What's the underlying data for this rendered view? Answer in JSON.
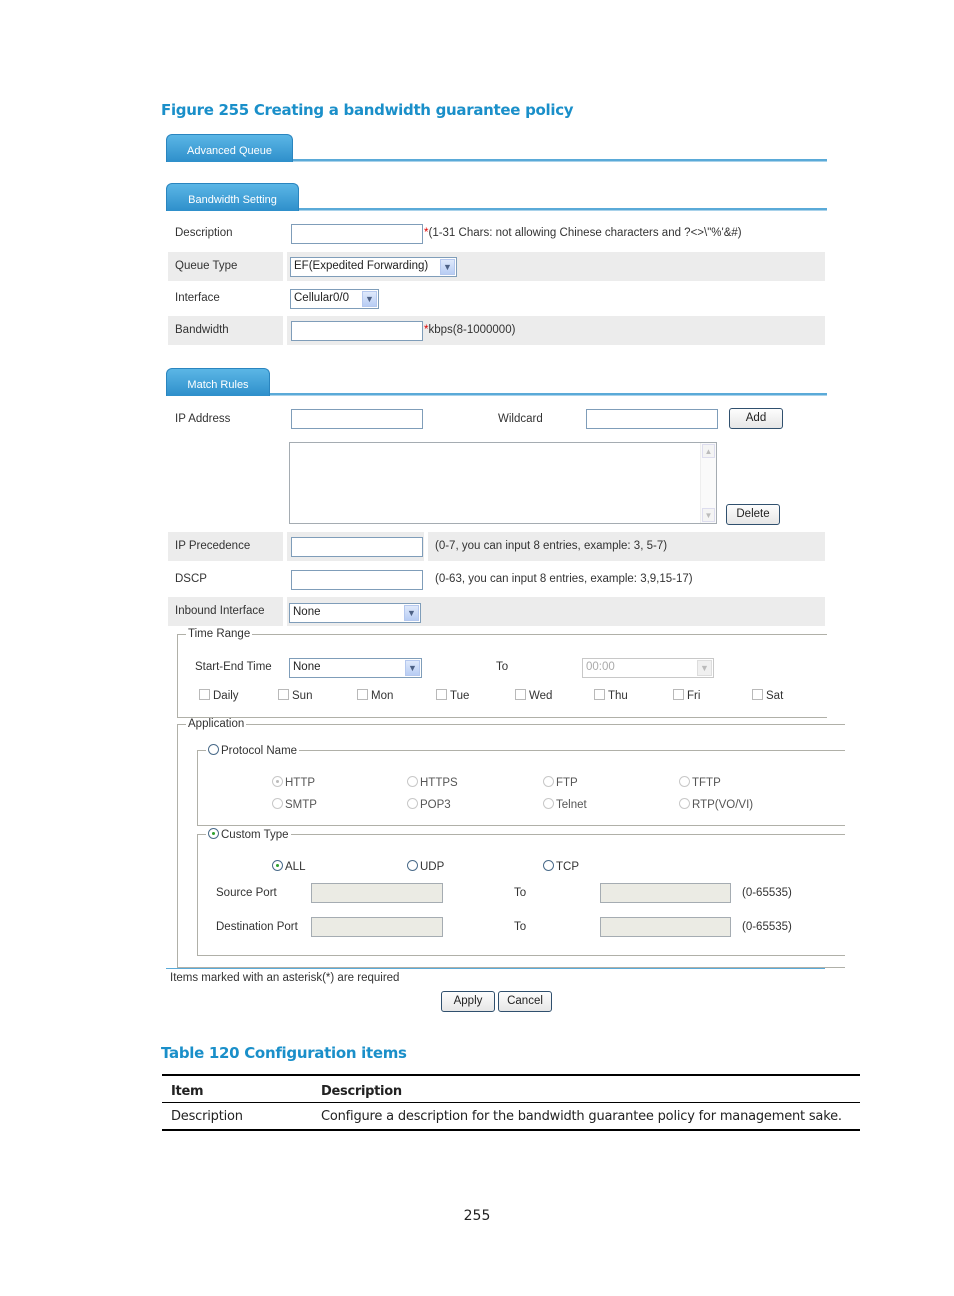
{
  "figure_caption": "Figure 255 Creating a bandwidth guarantee policy",
  "tabs": {
    "advanced_queue": "Advanced Queue",
    "bandwidth_setting": "Bandwidth Setting",
    "match_rules": "Match Rules"
  },
  "bandwidth_setting": {
    "description": {
      "label": "Description",
      "value": "",
      "required_mark": "*",
      "hint": "(1-31 Chars: not allowing Chinese characters and ?<>\\\"%'&#)"
    },
    "queue_type": {
      "label": "Queue Type",
      "selected": "EF(Expedited Forwarding)"
    },
    "interface": {
      "label": "Interface",
      "selected": "Cellular0/0"
    },
    "bandwidth": {
      "label": "Bandwidth",
      "value": "",
      "required_mark": "*",
      "hint": "kbps(8-1000000)"
    }
  },
  "match_rules": {
    "ip_address": {
      "label": "IP Address",
      "value": ""
    },
    "wildcard": {
      "label": "Wildcard",
      "value": ""
    },
    "add_button": "Add",
    "delete_button": "Delete",
    "rule_list": [],
    "ip_precedence": {
      "label": "IP Precedence",
      "value": "",
      "hint": "(0-7, you can input 8 entries, example: 3, 5-7)"
    },
    "dscp": {
      "label": "DSCP",
      "value": "",
      "hint": "(0-63, you can input 8 entries, example: 3,9,15-17)"
    },
    "inbound_interface": {
      "label": "Inbound Interface",
      "selected": "None"
    }
  },
  "time_range": {
    "legend": "Time Range",
    "start_end_label": "Start-End Time",
    "start_selected": "None",
    "to_label": "To",
    "end_selected": "00:00",
    "days": [
      {
        "label": "Daily",
        "checked": false
      },
      {
        "label": "Sun",
        "checked": false
      },
      {
        "label": "Mon",
        "checked": false
      },
      {
        "label": "Tue",
        "checked": false
      },
      {
        "label": "Wed",
        "checked": false
      },
      {
        "label": "Thu",
        "checked": false
      },
      {
        "label": "Fri",
        "checked": false
      },
      {
        "label": "Sat",
        "checked": false
      }
    ]
  },
  "application": {
    "legend": "Application",
    "protocol_name": {
      "label": "Protocol Name",
      "selected": false,
      "options": [
        {
          "label": "HTTP",
          "checked": true
        },
        {
          "label": "HTTPS",
          "checked": false
        },
        {
          "label": "FTP",
          "checked": false
        },
        {
          "label": "TFTP",
          "checked": false
        },
        {
          "label": "SMTP",
          "checked": false
        },
        {
          "label": "POP3",
          "checked": false
        },
        {
          "label": "Telnet",
          "checked": false
        },
        {
          "label": "RTP(VO/VI)",
          "checked": false
        }
      ]
    },
    "custom_type": {
      "label": "Custom Type",
      "selected": true,
      "protocols": [
        {
          "label": "ALL",
          "checked": true
        },
        {
          "label": "UDP",
          "checked": false
        },
        {
          "label": "TCP",
          "checked": false
        }
      ],
      "source_port": {
        "label": "Source Port",
        "from": "",
        "to_label": "To",
        "to": "",
        "range": "(0-65535)"
      },
      "destination_port": {
        "label": "Destination Port",
        "from": "",
        "to_label": "To",
        "to": "",
        "range": "(0-65535)"
      }
    }
  },
  "footer": {
    "required_note": "Items marked with an asterisk(*) are required",
    "apply_button": "Apply",
    "cancel_button": "Cancel"
  },
  "table_caption": "Table 120 Configuration items",
  "config_table": {
    "headers": [
      "Item",
      "Description"
    ],
    "rows": [
      [
        "Description",
        "Configure a description for the bandwidth guarantee policy for management sake."
      ]
    ]
  },
  "page_number": "255"
}
